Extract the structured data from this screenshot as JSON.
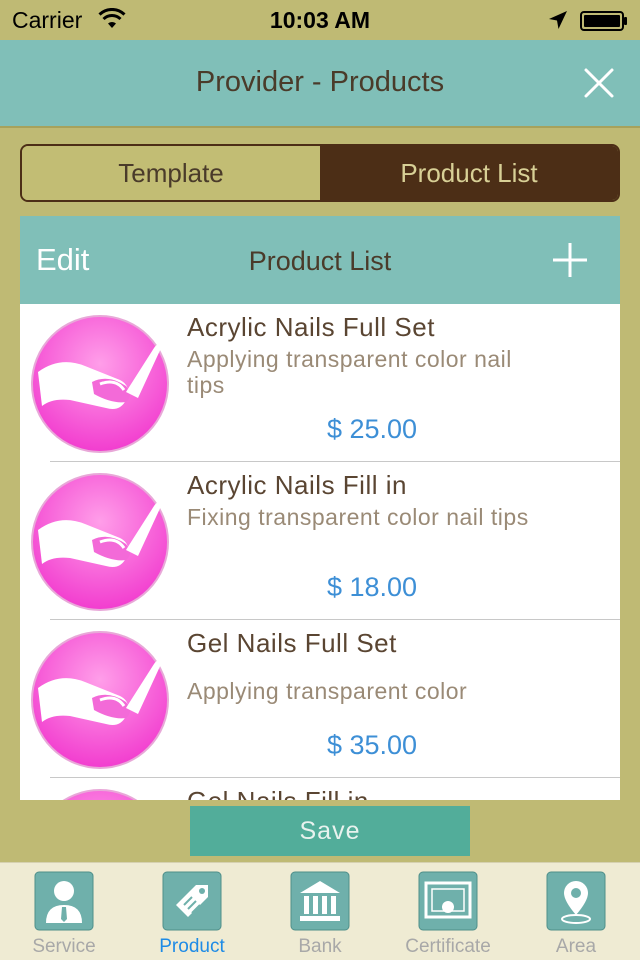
{
  "status_bar": {
    "carrier": "Carrier",
    "time": "10:03 AM"
  },
  "nav": {
    "title": "Provider - Products"
  },
  "segments": [
    {
      "label": "Template",
      "selected": false
    },
    {
      "label": "Product List",
      "selected": true
    }
  ],
  "panel": {
    "edit_label": "Edit",
    "title": "Product List"
  },
  "products": [
    {
      "title": "Acrylic Nails Full Set",
      "description": "Applying transparent color nail tips",
      "price": "$ 25.00"
    },
    {
      "title": "Acrylic Nails Fill in",
      "description": "Fixing transparent color nail tips",
      "price": "$ 18.00"
    },
    {
      "title": "Gel Nails Full Set",
      "description": "Applying transparent color",
      "price": "$ 35.00"
    },
    {
      "title": "Gel Nails Fill in",
      "description": "",
      "price": ""
    }
  ],
  "save_label": "Save",
  "tabs": [
    {
      "label": "Service",
      "icon": "person-icon",
      "selected": false
    },
    {
      "label": "Product",
      "icon": "tag-icon",
      "selected": true
    },
    {
      "label": "Bank",
      "icon": "bank-icon",
      "selected": false
    },
    {
      "label": "Certificate",
      "icon": "certificate-icon",
      "selected": false
    },
    {
      "label": "Area",
      "icon": "location-pin-icon",
      "selected": false
    }
  ],
  "colors": {
    "background": "#bfba74",
    "nav_teal": "#80bfb8",
    "segment_dark": "#4c2e16",
    "price_blue": "#3d8fd6",
    "save_green": "#52ad9a",
    "tab_selected": "#1e8be6",
    "thumb_pink": "#f757d6"
  }
}
